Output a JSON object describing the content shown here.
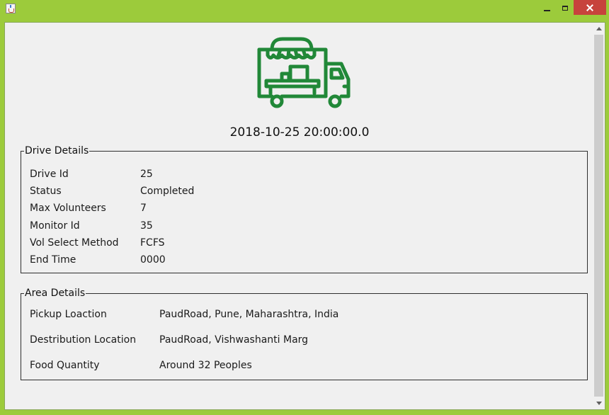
{
  "window": {
    "icon": "java-cup-icon",
    "controls": {
      "minimize": "minimize-icon",
      "maximize": "maximize-icon",
      "close": "close-icon"
    },
    "accent_color": "#9ccb3b",
    "close_color": "#c7433c"
  },
  "header": {
    "logo_icon": "food-truck-icon",
    "logo_color": "#218838",
    "datetime": "2018-10-25 20:00:00.0"
  },
  "drive_details": {
    "title": "Drive Details",
    "rows": [
      {
        "label": "Drive Id",
        "value": "25"
      },
      {
        "label": "Status",
        "value": "Completed"
      },
      {
        "label": "Max Volunteers",
        "value": "7"
      },
      {
        "label": "Monitor Id",
        "value": "35"
      },
      {
        "label": "Vol Select Method",
        "value": "FCFS"
      },
      {
        "label": "End Time",
        "value": "0000"
      }
    ]
  },
  "area_details": {
    "title": "Area Details",
    "rows": [
      {
        "label": "Pickup Loaction",
        "value": "PaudRoad, Pune, Maharashtra, India"
      },
      {
        "label": "Destribution Location",
        "value": "PaudRoad, Vishwashanti Marg"
      },
      {
        "label": "Food Quantity",
        "value": "Around 32 Peoples"
      }
    ]
  }
}
